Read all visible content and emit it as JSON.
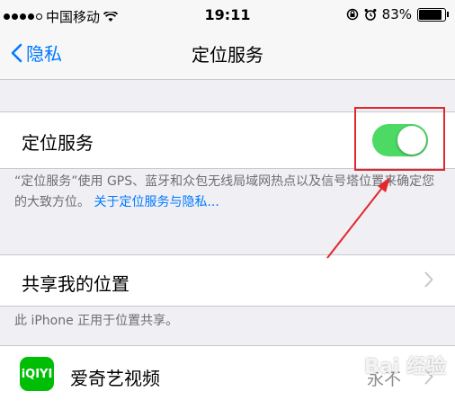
{
  "status_bar": {
    "carrier": "中国移动",
    "time": "19:11",
    "battery": "83%"
  },
  "nav": {
    "back_label": "隐私",
    "title": "定位服务"
  },
  "location_section": {
    "label": "定位服务",
    "toggle_on": true,
    "footer_text": "“定位服务”使用 GPS、蓝牙和众包无线局域网热点以及信号塔位置来确定您的大致方位。",
    "footer_link": "关于定位服务与隐私..."
  },
  "share_section": {
    "label": "共享我的位置",
    "footer_text": "此 iPhone 正用于位置共享。"
  },
  "apps": [
    {
      "icon_text": "iQIYI",
      "name": "爱奇艺视频",
      "value": "永不"
    }
  ],
  "colors": {
    "accent": "#007aff",
    "toggle_on": "#4cd964",
    "annotation": "#e0282d"
  },
  "watermark": "Bai 经验"
}
